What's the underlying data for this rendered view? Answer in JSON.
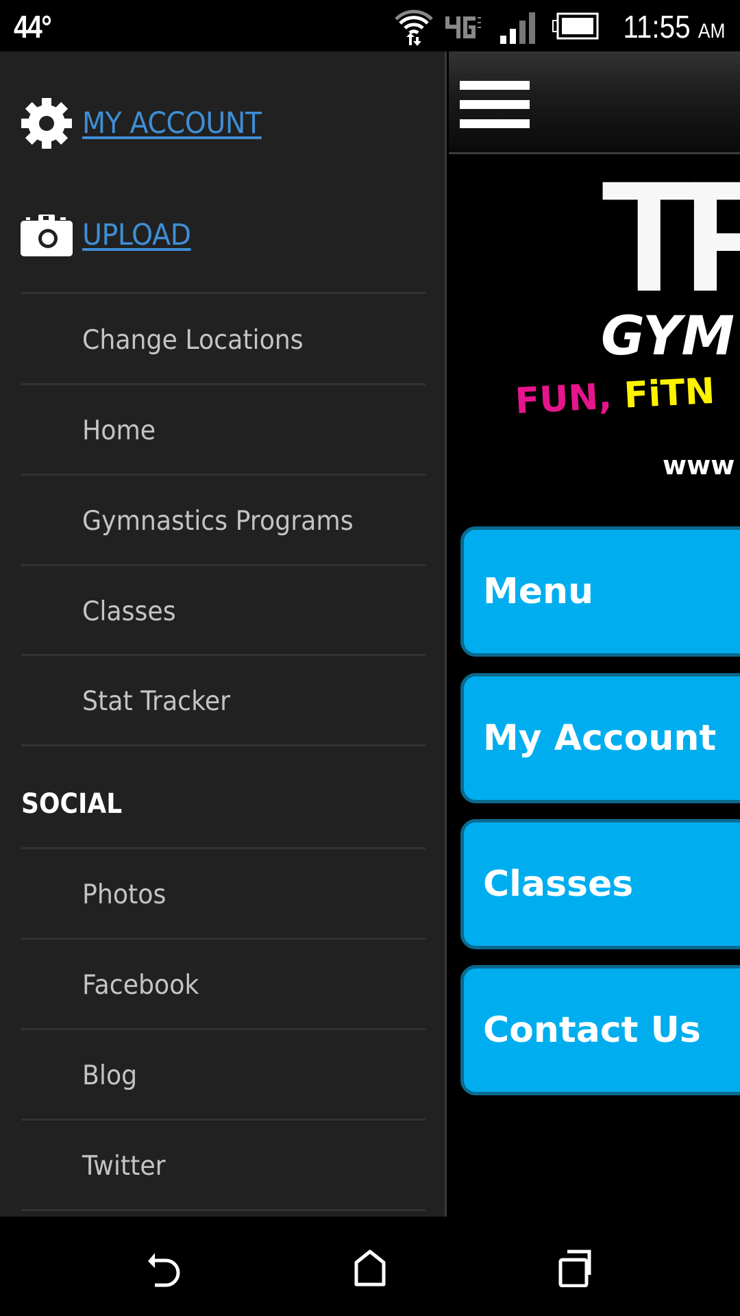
{
  "status_bar": {
    "temperature": "44°",
    "time": "11:55",
    "time_suffix": "AM",
    "network": "4G LTE",
    "icons": [
      "wifi-data-icon",
      "lte-icon",
      "signal-icon",
      "battery-icon"
    ]
  },
  "drawer": {
    "top_links": [
      {
        "label": "MY ACCOUNT",
        "icon": "gear-icon"
      },
      {
        "label": "UPLOAD",
        "icon": "camera-icon"
      }
    ],
    "items": [
      {
        "label": "Change Locations"
      },
      {
        "label": "Home"
      },
      {
        "label": "Gymnastics Programs"
      },
      {
        "label": "Classes"
      },
      {
        "label": "Stat Tracker"
      }
    ],
    "social_heading": "SOCIAL",
    "social_items": [
      {
        "label": "Photos"
      },
      {
        "label": "Facebook"
      },
      {
        "label": "Blog"
      },
      {
        "label": "Twitter"
      }
    ]
  },
  "app": {
    "header": {
      "menu_icon": "hamburger-icon"
    },
    "logo": {
      "title_partial": "TF",
      "subtitle_partial": "GYM",
      "tagline_pink": "FUN,",
      "tagline_yellow": "FiTN",
      "url_partial": "www"
    },
    "buttons": [
      {
        "label": "Menu"
      },
      {
        "label": "My Account"
      },
      {
        "label": "Classes"
      },
      {
        "label": "Contact Us"
      }
    ],
    "colors": {
      "button_fill": "#00aeef",
      "button_border": "#0b6a8f",
      "link": "#3f8ed5",
      "tagline_pink": "#e6158b",
      "tagline_yellow": "#fff200"
    }
  },
  "nav_bar": {
    "buttons": [
      "back-icon",
      "home-icon",
      "recents-icon"
    ]
  }
}
